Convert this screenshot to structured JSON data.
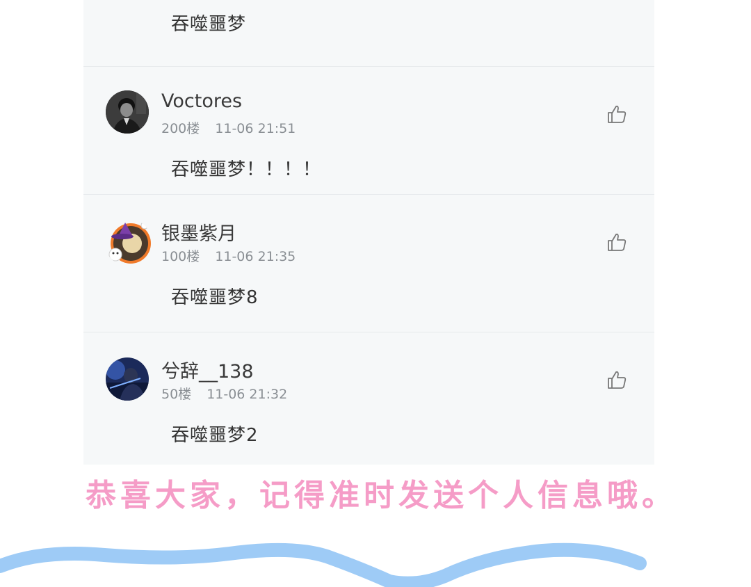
{
  "comments": [
    {
      "text": "吞噬噩梦"
    },
    {
      "username": "Voctores",
      "floor": "200楼",
      "time": "11-06 21:51",
      "text": "吞噬噩梦！！！！",
      "avatar_icon": "avatar-dark-portrait"
    },
    {
      "username": "银墨紫月",
      "floor": "100楼",
      "time": "11-06 21:35",
      "text": "吞噬噩梦8",
      "avatar_icon": "avatar-witch-hat-anime"
    },
    {
      "username": "兮辞__138",
      "floor": "50楼",
      "time": "11-06 21:32",
      "text": "吞噬噩梦2",
      "avatar_icon": "avatar-blue-scene"
    }
  ],
  "like_icon": "thumbs-up-icon",
  "banner": "恭喜大家，记得准时发送个人信息哦。",
  "colors": {
    "panel_bg": "#f6f8f9",
    "banner_pink": "#f59cc7",
    "wave_blue": "#9ecbf6",
    "meta_gray": "#8a8f94"
  }
}
